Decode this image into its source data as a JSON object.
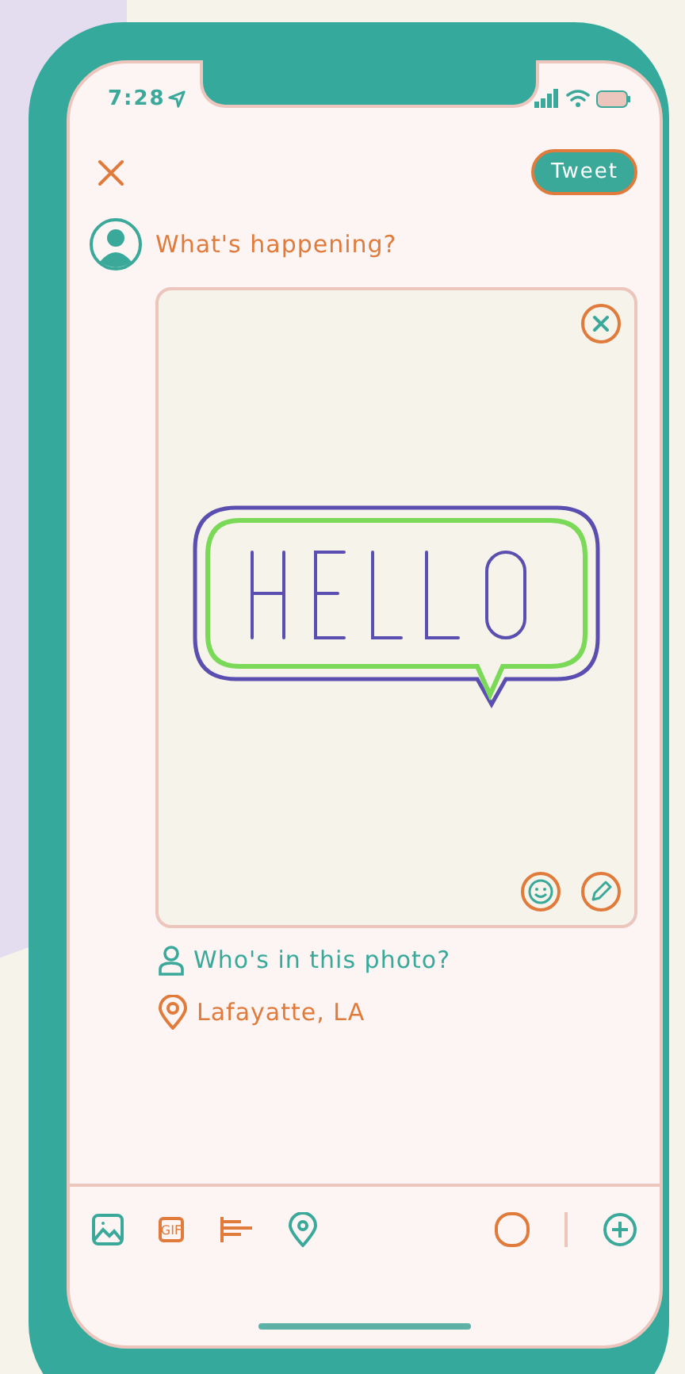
{
  "status_bar": {
    "time": "7:28"
  },
  "header": {
    "tweet_button": "Tweet"
  },
  "composer": {
    "placeholder": "What's happening?"
  },
  "photo_tag": "Who's in this photo?",
  "location": "Lafayatte, LA",
  "toolbar": {
    "gif_label": "GIF"
  }
}
